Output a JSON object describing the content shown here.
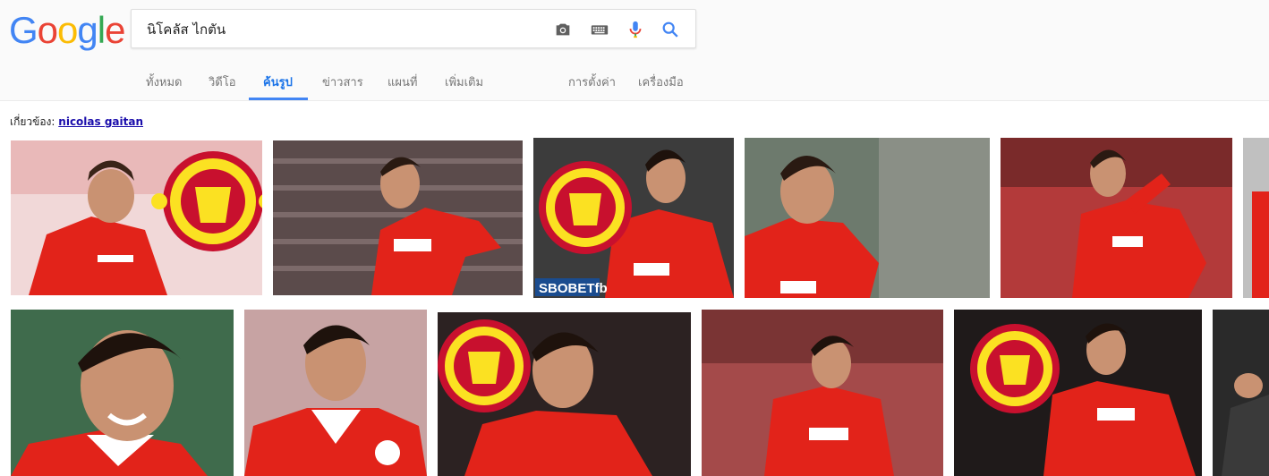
{
  "search": {
    "query": "นิโคลัส ไกตัน"
  },
  "logo": [
    "G",
    "o",
    "o",
    "g",
    "l",
    "e"
  ],
  "tabs": [
    {
      "label": "ทั้งหมด"
    },
    {
      "label": "วิดีโอ"
    },
    {
      "label": "ค้นรูป",
      "active": true
    },
    {
      "label": "ข่าวสาร"
    },
    {
      "label": "แผนที่"
    },
    {
      "label": "เพิ่มเติม"
    },
    {
      "label": "การตั้งค่า"
    },
    {
      "label": "เครื่องมือ"
    }
  ],
  "related": {
    "prefix": "เกี่ยวข้อง:",
    "link": "nicolas gaitan"
  },
  "images": {
    "row1": [
      {
        "subject": "player-with-man-utd-crest"
      },
      {
        "subject": "player-running-stadium"
      },
      {
        "subject": "player-crest-sbobet",
        "caption": "SBOBETfb"
      },
      {
        "subject": "player-closeup"
      },
      {
        "subject": "player-celebrating"
      },
      {
        "subject": "partial-image"
      }
    ],
    "row2": [
      {
        "subject": "player-smiling-portrait"
      },
      {
        "subject": "player-headshot"
      },
      {
        "subject": "player-with-man-utd-crest"
      },
      {
        "subject": "player-running-ball"
      },
      {
        "subject": "player-with-crest-dark"
      },
      {
        "subject": "partial-image"
      }
    ]
  },
  "colors": {
    "tab_active": "#1a73e8",
    "link": "#1a0dab",
    "jersey_red": "#e2231a",
    "crest_red": "#c8102e",
    "crest_yellow": "#fbe122"
  }
}
